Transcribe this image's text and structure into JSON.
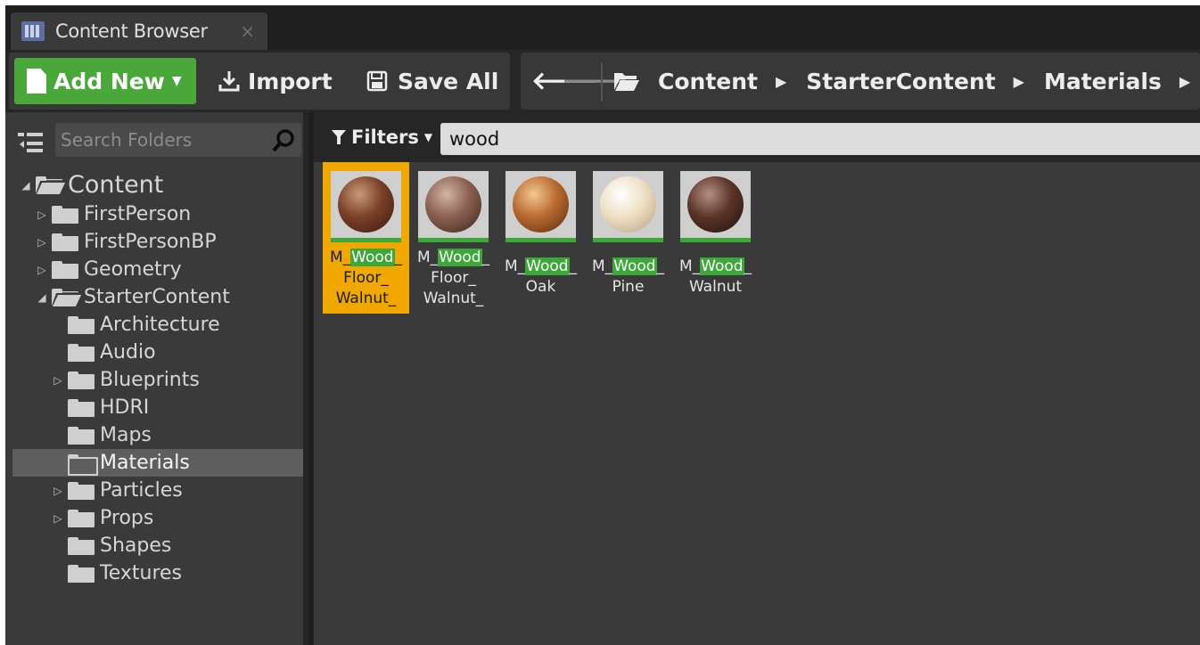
{
  "tab": {
    "title": "Content Browser",
    "close_glyph": "×"
  },
  "toolbar": {
    "add_new_label": "Add New",
    "import_label": "Import",
    "save_all_label": "Save All",
    "add_new_color": "#4aa83a"
  },
  "breadcrumbs": [
    "Content",
    "StarterContent",
    "Materials"
  ],
  "sources": {
    "search_placeholder": "Search Folders",
    "tree": [
      {
        "label": "Content",
        "depth": 0,
        "toggle": "expanded",
        "folder": "open",
        "big": true
      },
      {
        "label": "FirstPerson",
        "depth": 1,
        "toggle": "collapsed",
        "folder": "closed"
      },
      {
        "label": "FirstPersonBP",
        "depth": 1,
        "toggle": "collapsed",
        "folder": "closed"
      },
      {
        "label": "Geometry",
        "depth": 1,
        "toggle": "collapsed",
        "folder": "closed"
      },
      {
        "label": "StarterContent",
        "depth": 1,
        "toggle": "expanded",
        "folder": "open"
      },
      {
        "label": "Architecture",
        "depth": 2,
        "toggle": "none",
        "folder": "closed"
      },
      {
        "label": "Audio",
        "depth": 2,
        "toggle": "none",
        "folder": "closed"
      },
      {
        "label": "Blueprints",
        "depth": 2,
        "toggle": "collapsed",
        "folder": "closed"
      },
      {
        "label": "HDRI",
        "depth": 2,
        "toggle": "none",
        "folder": "closed"
      },
      {
        "label": "Maps",
        "depth": 2,
        "toggle": "none",
        "folder": "closed"
      },
      {
        "label": "Materials",
        "depth": 2,
        "toggle": "none",
        "folder": "hollow",
        "selected": true
      },
      {
        "label": "Particles",
        "depth": 2,
        "toggle": "collapsed",
        "folder": "closed"
      },
      {
        "label": "Props",
        "depth": 2,
        "toggle": "collapsed",
        "folder": "closed"
      },
      {
        "label": "Shapes",
        "depth": 2,
        "toggle": "none",
        "folder": "closed"
      },
      {
        "label": "Textures",
        "depth": 2,
        "toggle": "none",
        "folder": "closed"
      }
    ]
  },
  "assets": {
    "filters_label": "Filters",
    "search_value": "wood",
    "highlight_color": "#3da83a",
    "selected_color": "#f0a800",
    "items": [
      {
        "prefix": "M_",
        "match": "Wood",
        "suffix": "_",
        "lines": [
          "Floor_",
          "Walnut_"
        ],
        "selected": true,
        "colors": [
          "#c89a7a",
          "#7a4028",
          "#3a1a10"
        ]
      },
      {
        "prefix": "M_",
        "match": "Wood",
        "suffix": "_",
        "lines": [
          "Floor_",
          "Walnut_"
        ],
        "selected": false,
        "colors": [
          "#d2b4a4",
          "#8a6050",
          "#3a2218"
        ]
      },
      {
        "prefix": "M_",
        "match": "Wood",
        "suffix": "_",
        "lines": [
          "Oak"
        ],
        "selected": false,
        "colors": [
          "#f2c890",
          "#b86a30",
          "#5a2a10"
        ]
      },
      {
        "prefix": "M_",
        "match": "Wood",
        "suffix": "_",
        "lines": [
          "Pine"
        ],
        "selected": false,
        "colors": [
          "#ffffff",
          "#efe0c4",
          "#b4a080"
        ]
      },
      {
        "prefix": "M_",
        "match": "Wood",
        "suffix": "_",
        "lines": [
          "Walnut"
        ],
        "selected": false,
        "colors": [
          "#b49084",
          "#5a3426",
          "#241010"
        ]
      }
    ]
  }
}
